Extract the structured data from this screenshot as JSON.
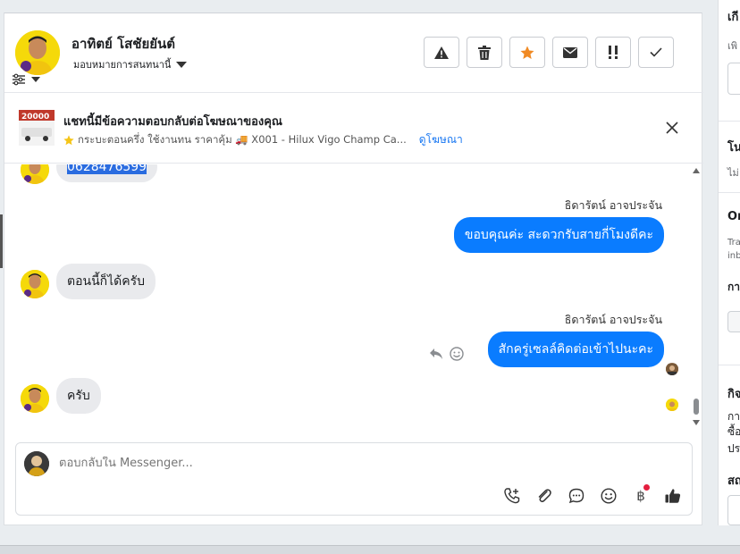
{
  "header": {
    "contact_name": "อาทิตย์ โสชัยยันต์",
    "assign_label": "มอบหมายการสนทนานี้"
  },
  "ad": {
    "title": "แชทนี้มีข้อความตอบกลับต่อโฆษณาของคุณ",
    "thumb_text": "20000",
    "description": "กระบะตอนครึ่ง ใช้งานทน ราคาคุ้ม 🚚 X001 - Hilux Vigo Champ Ca...",
    "link": "ดูโฆษณา"
  },
  "messages": [
    {
      "direction": "in",
      "text": "0628476599"
    },
    {
      "direction": "out",
      "sender": "ธิดารัตน์ อาจประจัน",
      "text": "ขอบคุณค่ะ สะดวกรับสายกี่โมงดีคะ"
    },
    {
      "direction": "in",
      "text": "ตอนนี้ก็ได้ครับ"
    },
    {
      "direction": "out",
      "sender": "ธิดารัตน์ อาจประจัน",
      "text": "สักครู่เซลล์คิดต่อเข้าไปนะคะ"
    },
    {
      "direction": "in",
      "text": "ครับ"
    }
  ],
  "composer": {
    "placeholder": "ตอบกลับใน Messenger...",
    "currency_symbol": "฿"
  },
  "right_panel": {
    "t1": "เกี",
    "t2": "เพิ",
    "t3": "โน",
    "t4": "ไม่",
    "t5": "Or",
    "t6": "Tra",
    "t7": "inb",
    "t8": "กา",
    "t9": "กิจ",
    "t10": "กา",
    "t11": "ซื้อ",
    "t12": "ปร",
    "t13": "สถ"
  },
  "colors": {
    "accent": "#0a7cff",
    "star": "#f08a24",
    "link": "#1877f2"
  }
}
